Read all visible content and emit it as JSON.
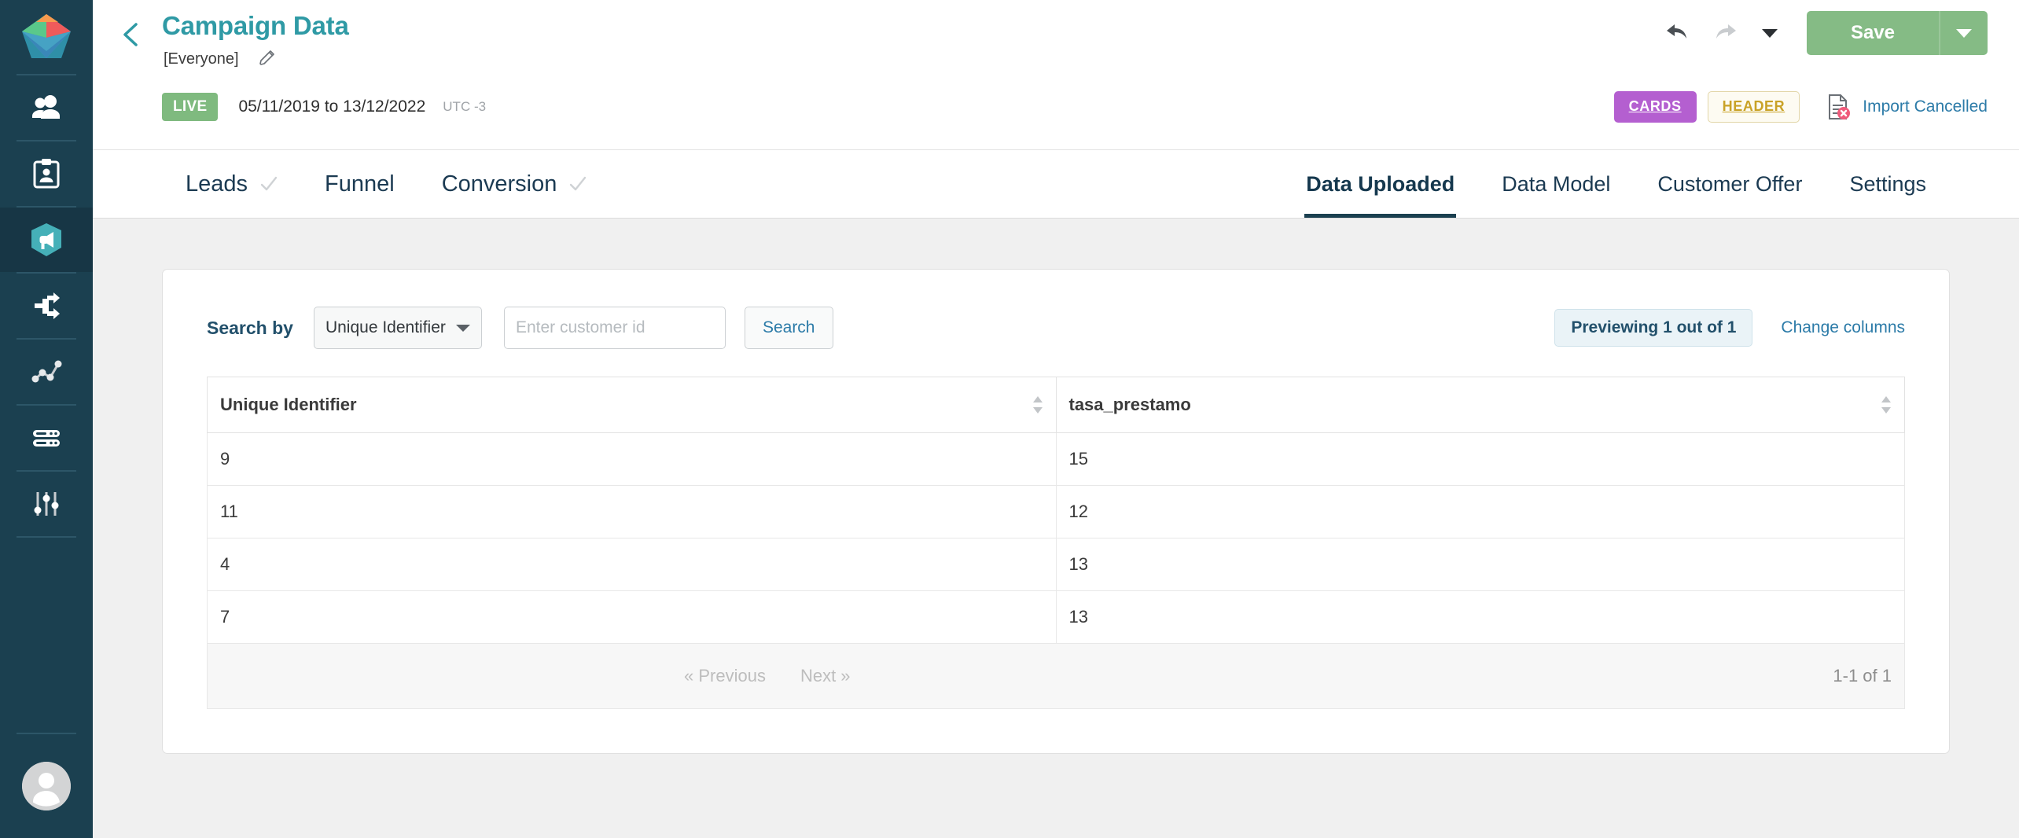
{
  "sidebar": {
    "logo_name": "app-logo",
    "items": [
      {
        "id": "audience",
        "icon": "people-icon",
        "active": false
      },
      {
        "id": "lists",
        "icon": "clipboard-user-icon",
        "active": false
      },
      {
        "id": "campaigns",
        "icon": "megaphone-icon",
        "active": true
      },
      {
        "id": "journeys",
        "icon": "share-nodes-icon",
        "active": false
      },
      {
        "id": "analytics",
        "icon": "line-chart-icon",
        "active": false
      },
      {
        "id": "data",
        "icon": "server-icon",
        "active": false
      },
      {
        "id": "settings",
        "icon": "sliders-icon",
        "active": false
      }
    ],
    "avatar_label": "user-avatar"
  },
  "header": {
    "back_label": "‹",
    "title": "Campaign Data",
    "subtitle": "[Everyone]",
    "edit_icon": "pencil-icon",
    "status_badge": "LIVE",
    "date_range": "05/11/2019  to  13/12/2022",
    "timezone": "UTC -3",
    "cards_badge": "CARDS",
    "header_badge": "HEADER",
    "import_status": "Import Cancelled",
    "import_icon": "document-error-icon",
    "undo_icon": "undo-arrow-icon",
    "redo_icon": "redo-arrow-icon",
    "more_icon": "caret-down-icon",
    "save_label": "Save",
    "save_split_icon": "caret-down-icon"
  },
  "tabs_left": [
    {
      "label": "Leads",
      "check": true
    },
    {
      "label": "Funnel",
      "check": false
    },
    {
      "label": "Conversion",
      "check": true
    }
  ],
  "tabs_right": [
    {
      "label": "Data Uploaded",
      "active": true
    },
    {
      "label": "Data Model",
      "active": false
    },
    {
      "label": "Customer Offer",
      "active": false
    },
    {
      "label": "Settings",
      "active": false
    }
  ],
  "toolbar": {
    "search_by_label": "Search by",
    "select_value": "Unique Identifier",
    "select_caret": "caret-down-icon",
    "input_placeholder": "Enter customer id",
    "input_value": "",
    "search_button": "Search",
    "preview_pill": "Previewing 1 out of 1",
    "change_columns": "Change columns"
  },
  "table": {
    "columns": [
      "Unique Identifier",
      "tasa_prestamo"
    ],
    "rows": [
      [
        "9",
        "15"
      ],
      [
        "11",
        "12"
      ],
      [
        "4",
        "13"
      ],
      [
        "7",
        "13"
      ]
    ],
    "pagination": {
      "previous": "« Previous",
      "next": "Next »",
      "count": "1-1 of 1"
    }
  },
  "colors": {
    "sidebar_bg": "#1b4050",
    "title_teal": "#2f9aa5",
    "live_green": "#7fba7f",
    "save_green": "#85bb85",
    "cards_purple": "#b45fd0",
    "header_gold": "#c9a227",
    "link_blue": "#2c7ba8",
    "accent_dark": "#1b4050"
  }
}
